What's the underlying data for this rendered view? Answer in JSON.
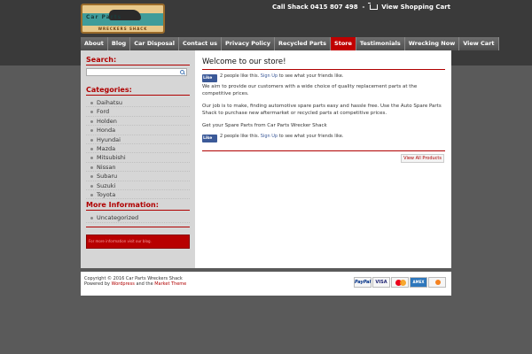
{
  "header": {
    "logo_text": "Car Parts",
    "logo_subtext": "WRECKERS SHACK",
    "call_text": "Call Shack 0415 807 498",
    "separator": "-",
    "cart_link": "View Shopping Cart"
  },
  "nav": {
    "items": [
      {
        "label": "About",
        "active": false
      },
      {
        "label": "Blog",
        "active": false
      },
      {
        "label": "Car Disposal",
        "active": false
      },
      {
        "label": "Contact us",
        "active": false
      },
      {
        "label": "Privacy Policy",
        "active": false
      },
      {
        "label": "Recycled Parts",
        "active": false
      },
      {
        "label": "Store",
        "active": true
      },
      {
        "label": "Testimonials",
        "active": false
      },
      {
        "label": "Wrecking Now",
        "active": false
      },
      {
        "label": "View Cart",
        "active": false
      }
    ]
  },
  "sidebar": {
    "search_heading": "Search:",
    "search_value": "",
    "categories_heading": "Categories:",
    "categories": [
      "Daihatsu",
      "Ford",
      "Holden",
      "Honda",
      "Hyundai",
      "Mazda",
      "Mitsubishi",
      "Nissan",
      "Subaru",
      "Suzuki",
      "Toyota"
    ],
    "more_heading": "More Information:",
    "more_items": [
      "Uncategorized"
    ],
    "more_box_text": "For more information visit our blog."
  },
  "content": {
    "title": "Welcome to our store!",
    "fb": {
      "like_label": "Like",
      "text_before": "2 people like this.",
      "signup_link": "Sign Up",
      "text_after": "to see what your friends like."
    },
    "paragraphs": [
      "We aim to provide our customers with a wide choice of quality replacement parts at the competitive prices.",
      "Our job is to make, finding automotive spare parts easy and hassle free. Use the Auto Spare Parts Shack to purchase new aftermarket or recycled parts at competitive prices.",
      "Get your Spare Parts from Car Parts Wrecker Shack"
    ],
    "view_all": "View All Products"
  },
  "footer": {
    "copyright": "Copyright © 2016 Car Parts Wreckers Shack",
    "powered_prefix": "Powered by",
    "wordpress_link": "Wordpress",
    "and_text": "and the",
    "theme_link": "Market Theme",
    "cards": [
      "PayPal",
      "VISA",
      "MasterCard",
      "AMEX",
      "Discover"
    ]
  },
  "colors": {
    "accent": "#b00000",
    "nav_active": "#c00000",
    "facebook": "#3b5998"
  }
}
